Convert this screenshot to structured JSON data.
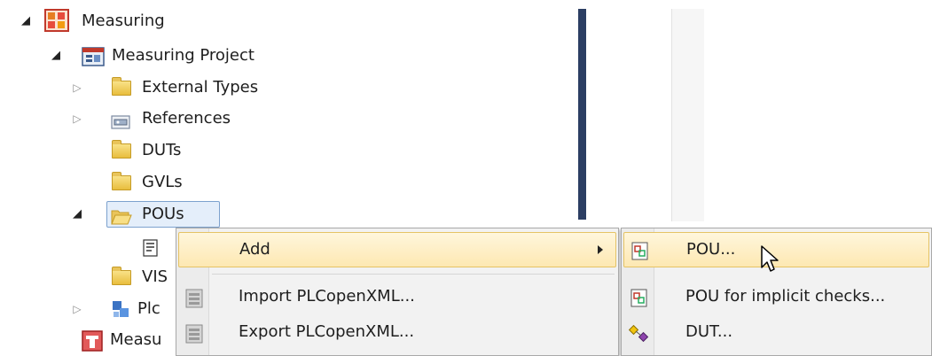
{
  "tree": {
    "root_label": "Measuring",
    "project_label": "Measuring Project",
    "items": [
      {
        "label": "External Types"
      },
      {
        "label": "References"
      },
      {
        "label": "DUTs"
      },
      {
        "label": "GVLs"
      },
      {
        "label": "POUs"
      },
      {
        "label": "VIS"
      },
      {
        "label": "Plc"
      },
      {
        "label": "Measu"
      }
    ]
  },
  "context_menu": {
    "items": [
      {
        "label": "Add"
      },
      {
        "label": "Import PLCopenXML..."
      },
      {
        "label": "Export PLCopenXML..."
      }
    ]
  },
  "submenu": {
    "items": [
      {
        "label": "POU..."
      },
      {
        "label": "POU for implicit checks..."
      },
      {
        "label": "DUT..."
      }
    ]
  },
  "colors": {
    "highlight": "#fde8b2",
    "splitter": "#2c3e63",
    "folder": "#e8bd3d"
  }
}
